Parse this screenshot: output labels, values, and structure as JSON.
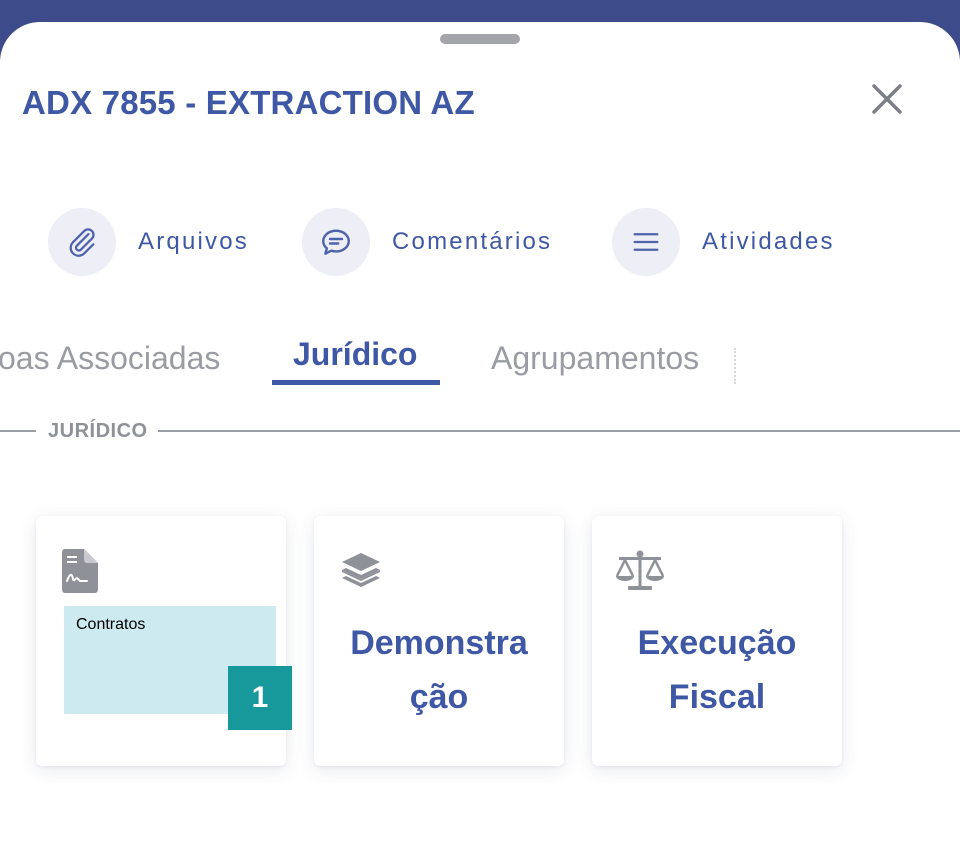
{
  "header": {
    "title": "ADX 7855 - EXTRACTION AZ",
    "close_icon": "close-icon"
  },
  "actions": [
    {
      "label": "Arquivos",
      "icon": "paperclip-icon"
    },
    {
      "label": "Comentários",
      "icon": "comment-icon"
    },
    {
      "label": "Atividades",
      "icon": "list-icon"
    }
  ],
  "tabs": [
    {
      "label": "oas Associadas",
      "active": false
    },
    {
      "label": "Jurídico",
      "active": true
    },
    {
      "label": "Agrupamentos",
      "active": false
    }
  ],
  "section": {
    "label": "JURÍDICO"
  },
  "cards": [
    {
      "lines": [
        "Contratos"
      ],
      "icon": "contract-file-icon",
      "badge": "1"
    },
    {
      "lines": [
        "Demonstra",
        "ção"
      ],
      "icon": "layers-icon"
    },
    {
      "lines": [
        "Execução",
        "Fiscal"
      ],
      "icon": "scale-icon"
    }
  ],
  "colors": {
    "primary": "#3f58a5",
    "header_band": "#3d4b8a",
    "badge": "#17989b",
    "highlight": "#cdeaf0",
    "muted": "#9a9ca3"
  }
}
